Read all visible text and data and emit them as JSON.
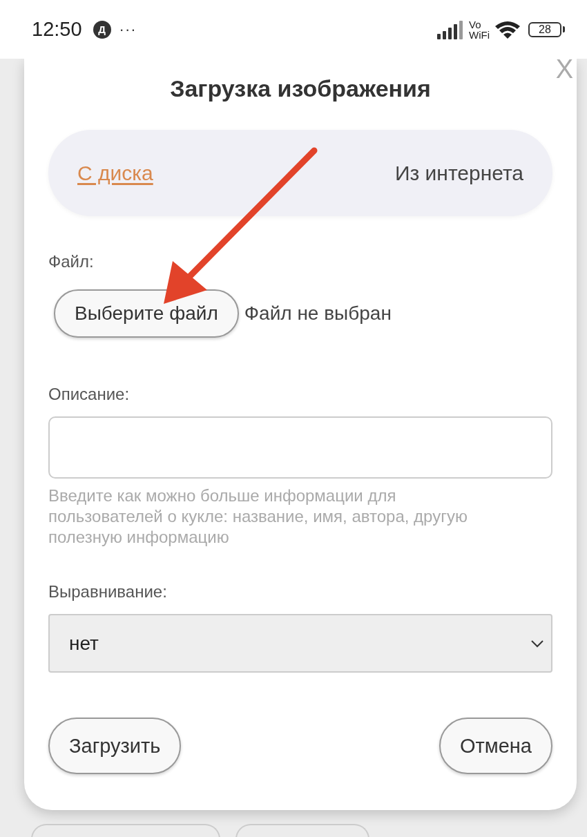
{
  "status_bar": {
    "time": "12:50",
    "notification_badge": "Д",
    "more": "···",
    "vowifi_top": "Vo",
    "vowifi_bottom": "WiFi",
    "battery": "28"
  },
  "dialog": {
    "close": "X",
    "title": "Загрузка изображения",
    "tabs": [
      {
        "label": "С диска",
        "selected": true
      },
      {
        "label": "Из интернета",
        "selected": false
      }
    ],
    "file_label": "Файл:",
    "file_button": "Выберите файл",
    "file_status": "Файл не выбран",
    "description_label": "Описание:",
    "description_hint": "Введите как можно больше информации для пользователей о кукле: название, имя, автора, другую полезную информацию",
    "alignment_label": "Выравнивание:",
    "alignment_select": {
      "value": "нет"
    },
    "buttons": [
      "Загрузить",
      "Отмена"
    ]
  }
}
